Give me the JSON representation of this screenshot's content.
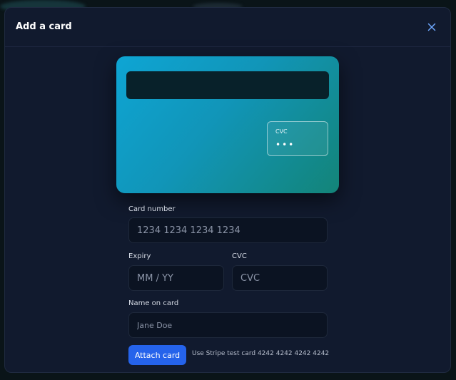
{
  "modal": {
    "title": "Add a card",
    "close_icon": "close-icon"
  },
  "card_preview": {
    "cvc_label": "CVC",
    "cvc_value": "•••"
  },
  "form": {
    "card_number": {
      "label": "Card number",
      "placeholder": "1234 1234 1234 1234",
      "value": ""
    },
    "expiry": {
      "label": "Expiry",
      "placeholder": "MM / YY",
      "value": ""
    },
    "cvc": {
      "label": "CVC",
      "placeholder": "CVC",
      "value": ""
    },
    "name": {
      "label": "Name on card",
      "placeholder": "Jane Doe",
      "value": ""
    }
  },
  "actions": {
    "attach_label": "Attach card",
    "hint": "Use Stripe test card 4242 4242 4242 4242"
  },
  "colors": {
    "accent": "#2563eb",
    "modal_bg": "#111a2e",
    "card_gradient_start": "#0ea5d4",
    "card_gradient_end": "#138478"
  }
}
